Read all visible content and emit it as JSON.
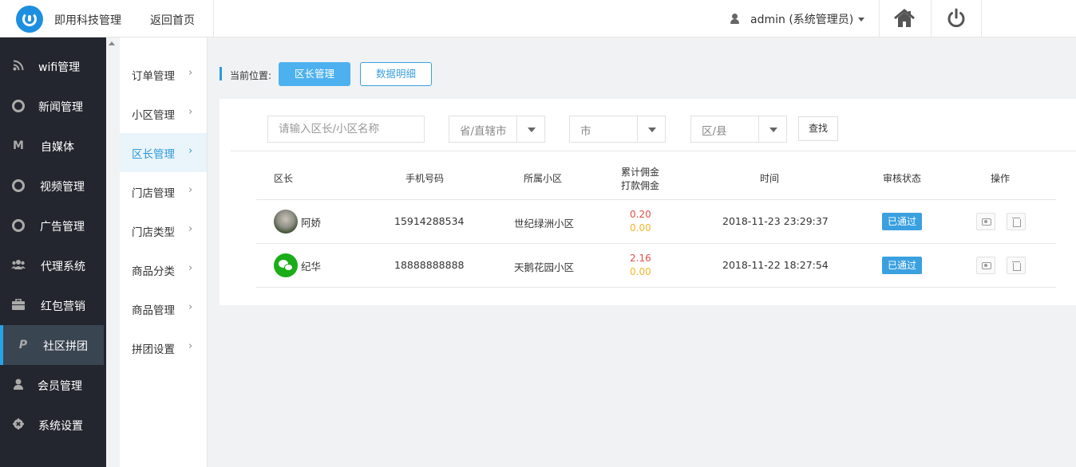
{
  "header": {
    "brand": "即用科技管理",
    "back_home": "返回首页",
    "user": "admin (系统管理员)"
  },
  "sidebar": {
    "items": [
      {
        "label": "wifi管理",
        "icon": "rss-icon"
      },
      {
        "label": "新闻管理",
        "icon": "lifebuoy-icon"
      },
      {
        "label": "自媒体",
        "icon": "medium-m-icon"
      },
      {
        "label": "视频管理",
        "icon": "lifebuoy-icon"
      },
      {
        "label": "广告管理",
        "icon": "lifebuoy-icon"
      },
      {
        "label": "代理系统",
        "icon": "users-icon"
      },
      {
        "label": "红包营销",
        "icon": "briefcase-icon"
      },
      {
        "label": "社区拼团",
        "icon": "paypal-icon",
        "active": true
      },
      {
        "label": "会员管理",
        "icon": "user-icon"
      },
      {
        "label": "系统设置",
        "icon": "gear-icon"
      }
    ]
  },
  "submenu": {
    "items": [
      {
        "label": "订单管理"
      },
      {
        "label": "小区管理"
      },
      {
        "label": "区长管理",
        "active": true
      },
      {
        "label": "门店管理"
      },
      {
        "label": "门店类型"
      },
      {
        "label": "商品分类"
      },
      {
        "label": "商品管理"
      },
      {
        "label": "拼团设置"
      }
    ]
  },
  "breadcrumb": {
    "label": "当前位置:",
    "current": "区长管理",
    "other": "数据明细"
  },
  "filters": {
    "keyword_placeholder": "请输入区长/小区名称",
    "province": "省/直辖市",
    "city": "市",
    "district": "区/县",
    "search_label": "查找"
  },
  "table": {
    "headers": {
      "leader": "区长",
      "phone": "手机号码",
      "community": "所属小区",
      "commission_total": "累计佣金",
      "commission_paid": "打款佣金",
      "time": "时间",
      "status": "审核状态",
      "actions": "操作"
    },
    "rows": [
      {
        "name": "阿娇",
        "phone": "15914288534",
        "community": "世纪绿洲小区",
        "commission_total": "0.20",
        "commission_paid": "0.00",
        "time": "2018-11-23 23:29:37",
        "status": "已通过"
      },
      {
        "name": "纪华",
        "phone": "18888888888",
        "community": "天鹅花园小区",
        "commission_total": "2.16",
        "commission_paid": "0.00",
        "time": "2018-11-22 18:27:54",
        "status": "已通过"
      }
    ]
  },
  "colors": {
    "accent": "#4db1ef",
    "sidebar_bg": "#23262e",
    "commission_total": "#e0504a",
    "commission_paid": "#f5b42a"
  }
}
